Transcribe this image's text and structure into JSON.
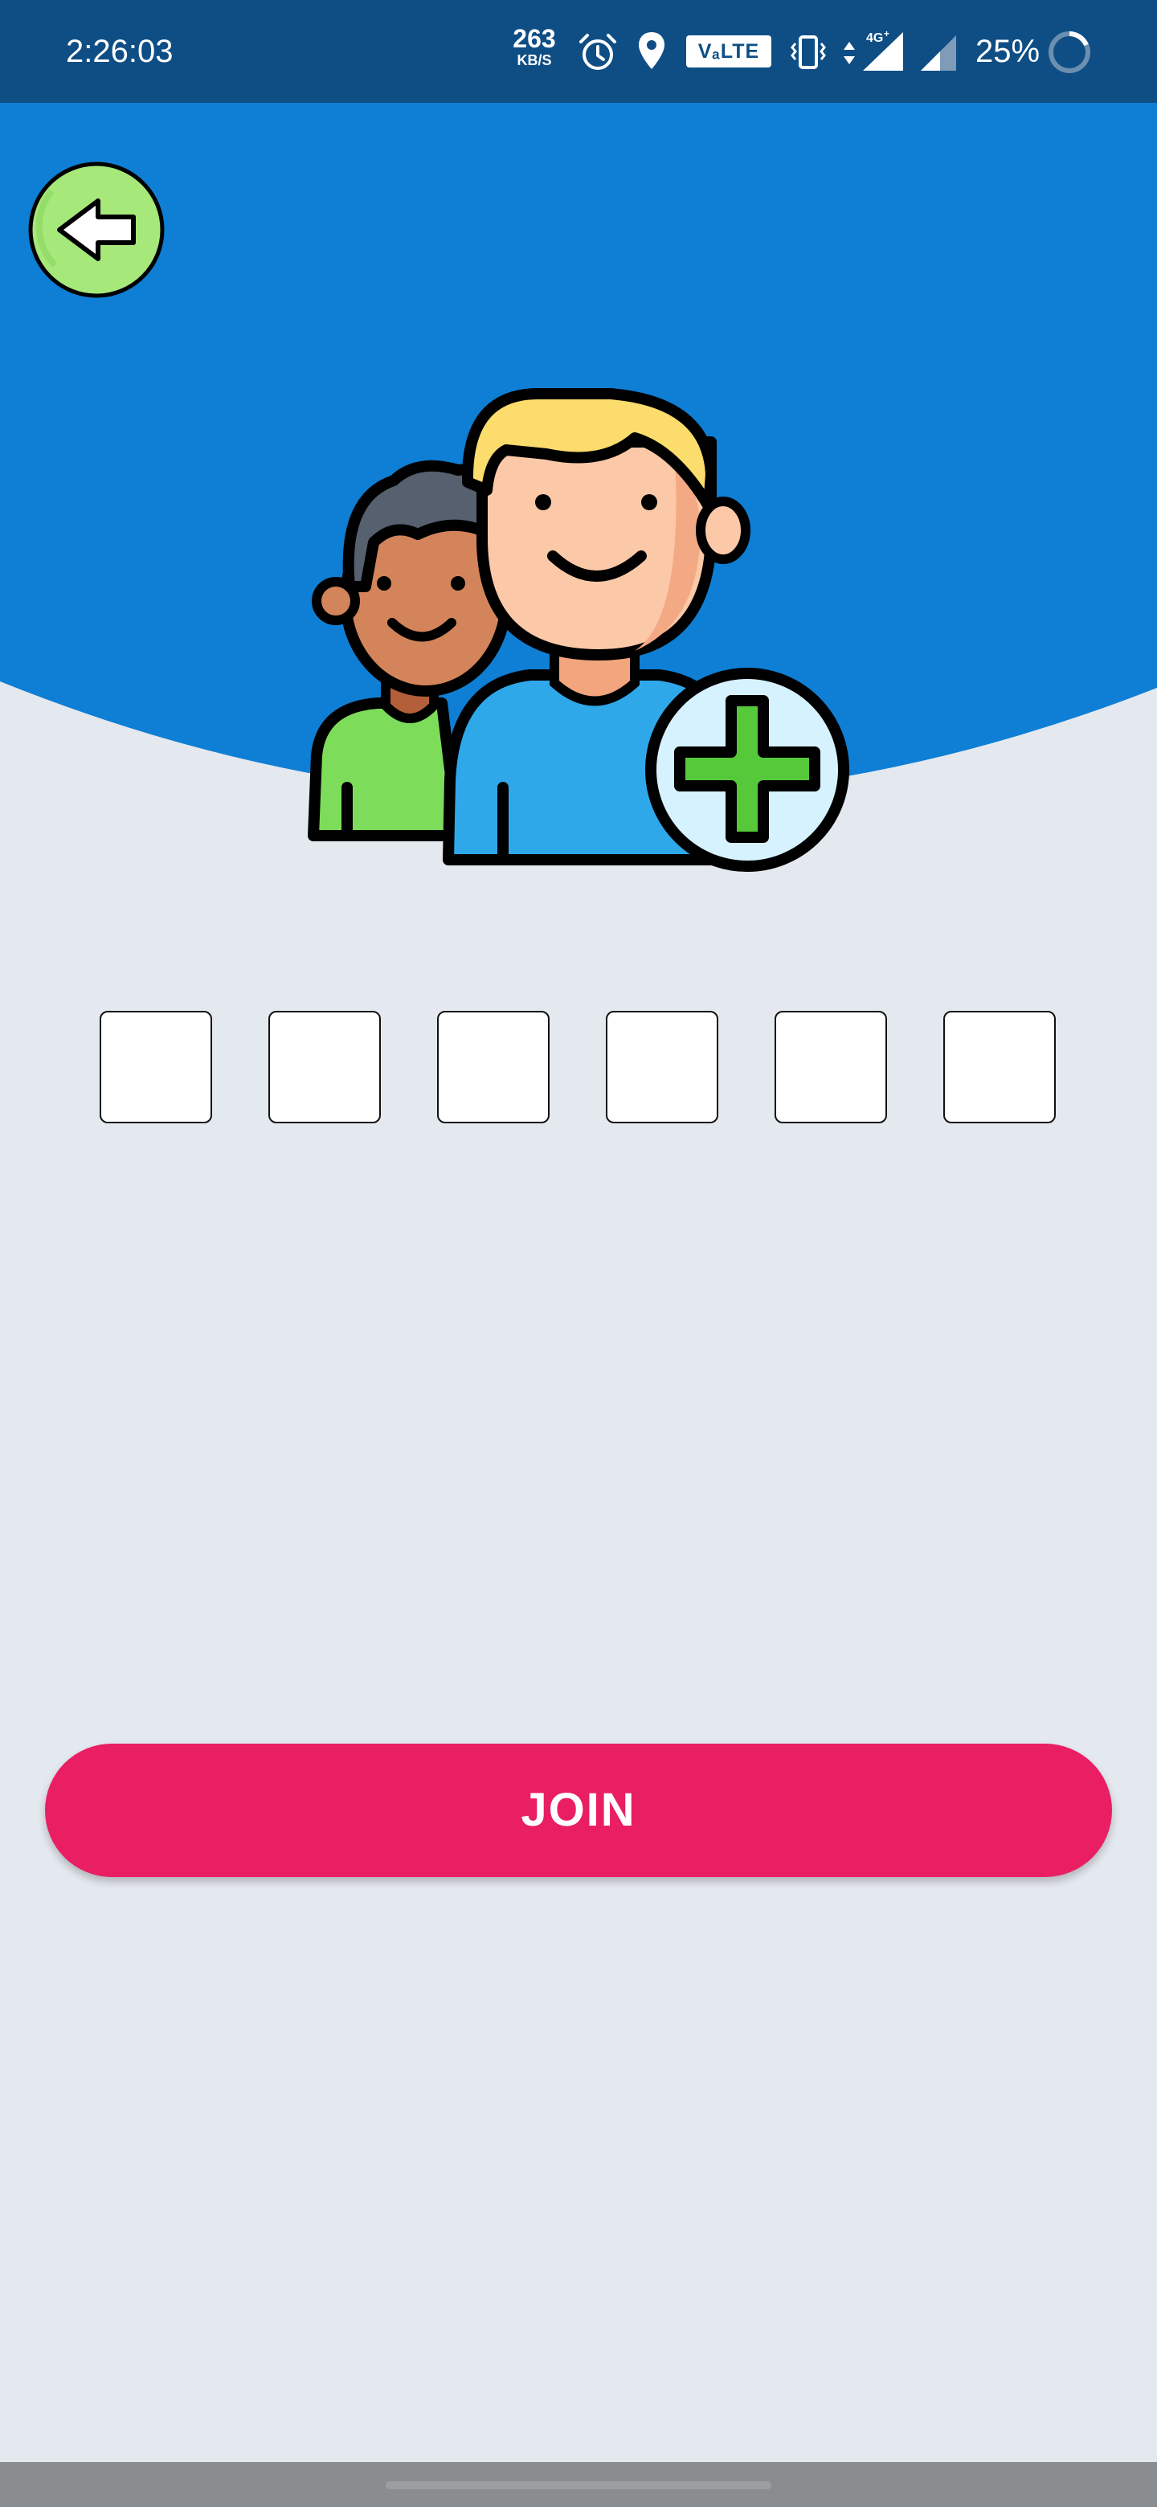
{
  "status_bar": {
    "time": "2:26:03",
    "net_speed_value": "263",
    "net_speed_unit": "KB/S",
    "volte_label": "VₐLTE",
    "battery_percent": "25%",
    "icons": [
      "alarm-icon",
      "location-icon",
      "vibrate-icon",
      "data-arrows-icon",
      "signal-4g-icon",
      "signal-icon",
      "battery-ring-icon"
    ]
  },
  "header": {
    "back_icon": "arrow-left-icon",
    "illustration": "add-friend-icon"
  },
  "code_input": {
    "boxes": [
      "",
      "",
      "",
      "",
      "",
      ""
    ]
  },
  "join_button_label": "JOIN",
  "colors": {
    "status_bar": "#0e4e85",
    "header_blue": "#0e7fd4",
    "page_background": "#e4e8ef",
    "join_button": "#e91e63",
    "back_button": "#a6e87a"
  }
}
